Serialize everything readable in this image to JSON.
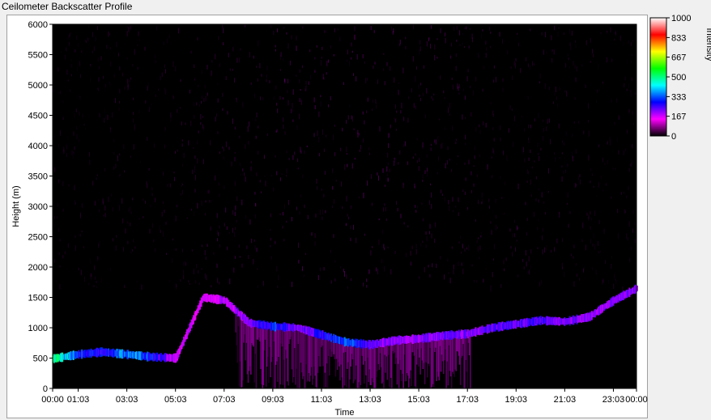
{
  "window": {
    "title": "Ceilometer Backscatter Profile"
  },
  "chart_data": {
    "type": "heatmap",
    "title": "Ceilometer Backscatter Profile",
    "xlabel": "Time",
    "ylabel": "Height (m)",
    "x_ticks": [
      "00:00",
      "01:03",
      "03:03",
      "05:03",
      "07:03",
      "09:03",
      "11:03",
      "13:03",
      "15:03",
      "17:03",
      "19:03",
      "21:03",
      "23:03",
      "00:00"
    ],
    "y_ticks": [
      0,
      500,
      1000,
      1500,
      2000,
      2500,
      3000,
      3500,
      4000,
      4500,
      5000,
      5500,
      6000
    ],
    "ylim": [
      0,
      6000
    ],
    "xlim": [
      "00:00",
      "00:00"
    ],
    "colorbar": {
      "label": "Intensity",
      "ticks": [
        0,
        167,
        333,
        500,
        667,
        833,
        1000
      ],
      "range": [
        0,
        1000
      ],
      "colors": [
        "#000000",
        "#ff00ff",
        "#0000ff",
        "#00ffff",
        "#00ff00",
        "#ffff00",
        "#ff0000",
        "#ffffff"
      ]
    },
    "cloud_base_layer": {
      "time": [
        "00:00",
        "01:03",
        "02:00",
        "03:03",
        "04:00",
        "05:03",
        "06:10",
        "07:03",
        "08:03",
        "09:03",
        "10:03",
        "11:03",
        "12:03",
        "13:03",
        "14:03",
        "15:03",
        "16:03",
        "17:03",
        "18:03",
        "19:03",
        "20:03",
        "21:03",
        "22:03",
        "23:03",
        "00:00"
      ],
      "height": [
        490,
        560,
        600,
        560,
        520,
        500,
        1500,
        1450,
        1080,
        1020,
        1000,
        880,
        760,
        720,
        790,
        820,
        870,
        900,
        1000,
        1060,
        1120,
        1100,
        1180,
        1450,
        1650
      ],
      "intensity": [
        520,
        300,
        260,
        380,
        300,
        160,
        150,
        180,
        210,
        300,
        220,
        260,
        330,
        240,
        200,
        210,
        220,
        210,
        230,
        240,
        240,
        220,
        200,
        200,
        220
      ]
    }
  }
}
